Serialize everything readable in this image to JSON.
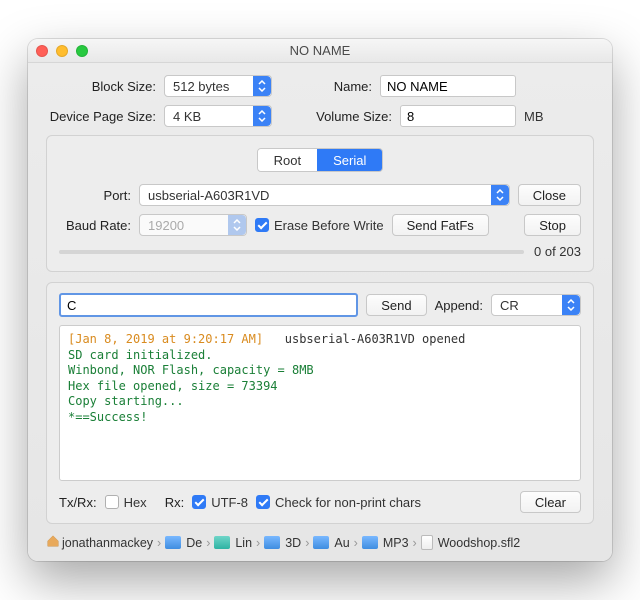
{
  "window": {
    "title": "NO NAME"
  },
  "form": {
    "block_size": {
      "label": "Block Size:",
      "value": "512 bytes"
    },
    "device_page_size": {
      "label": "Device Page Size:",
      "value": "4 KB"
    },
    "name": {
      "label": "Name:",
      "value": "NO NAME"
    },
    "volume_size": {
      "label": "Volume Size:",
      "value": "8",
      "unit": "MB"
    }
  },
  "serial": {
    "tab_root": "Root",
    "tab_serial": "Serial",
    "port_label": "Port:",
    "port_value": "usbserial-A603R1VD",
    "close": "Close",
    "baud_label": "Baud Rate:",
    "baud_value": "19200",
    "erase": "Erase Before Write",
    "send_fatfs": "Send FatFs",
    "stop": "Stop",
    "progress_text": "0 of 203"
  },
  "cmd": {
    "value": "C",
    "send": "Send",
    "append_label": "Append:",
    "append_value": "CR"
  },
  "terminal": {
    "timestamp": "[Jan 8, 2019 at 9:20:17 AM]",
    "open_msg": "   usbserial-A603R1VD opened",
    "lines": "SD card initialized.\nWinbond, NOR Flash, capacity = 8MB\nHex file opened, size = 73394\nCopy starting...\n*==Success!"
  },
  "flags": {
    "txrx": "Tx/Rx:",
    "hex": "Hex",
    "rx": "Rx:",
    "utf8": "UTF-8",
    "nonprint": "Check for non-print chars",
    "clear": "Clear"
  },
  "crumbs": {
    "home": "jonathanmackey",
    "items": [
      "De",
      "Lin",
      "3D",
      "Au",
      "MP3"
    ],
    "file": "Woodshop.sfl2"
  }
}
